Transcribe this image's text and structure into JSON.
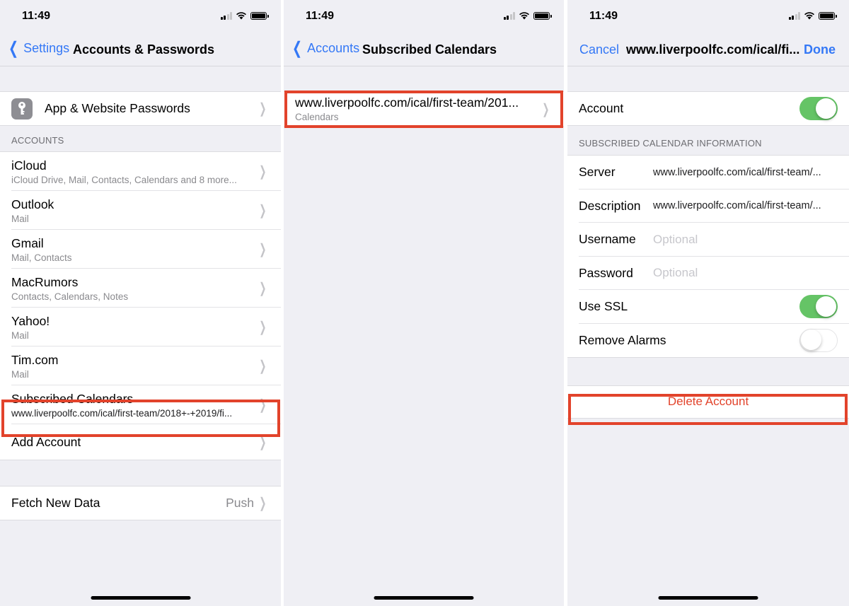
{
  "status_bar": {
    "time": "11:49"
  },
  "screen1": {
    "nav": {
      "back_label": "Settings",
      "title": "Accounts & Passwords"
    },
    "passwords_row": {
      "label": "App & Website Passwords",
      "icon": "key-icon"
    },
    "accounts_header": "ACCOUNTS",
    "accounts": [
      {
        "title": "iCloud",
        "subtitle": "iCloud Drive, Mail, Contacts, Calendars and 8 more..."
      },
      {
        "title": "Outlook",
        "subtitle": "Mail"
      },
      {
        "title": "Gmail",
        "subtitle": "Mail, Contacts"
      },
      {
        "title": "MacRumors",
        "subtitle": "Contacts, Calendars, Notes"
      },
      {
        "title": "Yahoo!",
        "subtitle": "Mail"
      },
      {
        "title": "Tim.com",
        "subtitle": "Mail"
      },
      {
        "title": "Subscribed Calendars",
        "subtitle": "www.liverpoolfc.com/ical/first-team/2018+-+2019/fi...",
        "highlighted": true
      }
    ],
    "add_account": "Add Account",
    "fetch": {
      "label": "Fetch New Data",
      "value": "Push"
    }
  },
  "screen2": {
    "nav": {
      "back_label": "Accounts",
      "title": "Subscribed Calendars"
    },
    "calendar_row": {
      "title": "www.liverpoolfc.com/ical/first-team/201...",
      "subtitle": "Calendars",
      "highlighted": true
    }
  },
  "screen3": {
    "nav": {
      "cancel_label": "Cancel",
      "title": "www.liverpoolfc.com/ical/fi...",
      "done_label": "Done"
    },
    "account_toggle": {
      "label": "Account",
      "on": true
    },
    "info_header": "SUBSCRIBED CALENDAR INFORMATION",
    "fields": [
      {
        "label": "Server",
        "value": "www.liverpoolfc.com/ical/first-team/...",
        "placeholder": ""
      },
      {
        "label": "Description",
        "value": "www.liverpoolfc.com/ical/first-team/...",
        "placeholder": ""
      },
      {
        "label": "Username",
        "value": "",
        "placeholder": "Optional"
      },
      {
        "label": "Password",
        "value": "",
        "placeholder": "Optional"
      }
    ],
    "ssl_toggle": {
      "label": "Use SSL",
      "on": true
    },
    "alarms_toggle": {
      "label": "Remove Alarms",
      "on": false
    },
    "delete_label": "Delete Account"
  },
  "colors": {
    "accent": "#3478f6",
    "toggle_on": "#65c466",
    "destructive": "#e2432b",
    "highlight_box": "#e2432b"
  }
}
